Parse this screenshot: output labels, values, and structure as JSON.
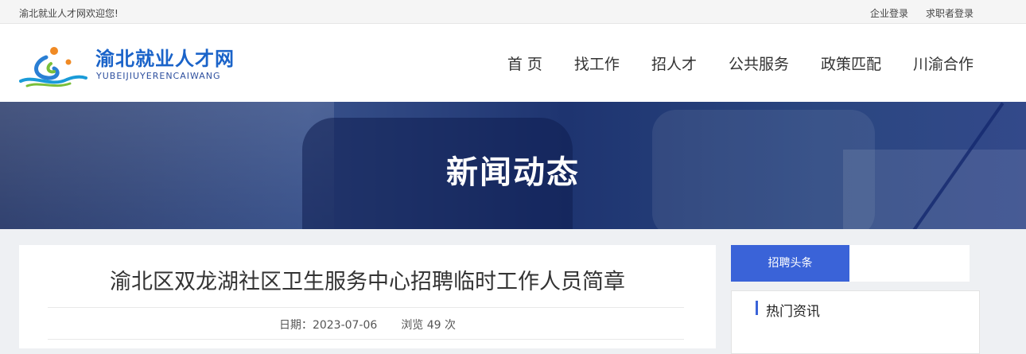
{
  "topbar": {
    "welcome": "渝北就业人才网欢迎您!",
    "company_login": "企业登录",
    "seeker_login": "求职者登录"
  },
  "logo": {
    "name_cn": "渝北就业人才网",
    "name_en": "YUBEIJIUYERENCAIWANG"
  },
  "nav": {
    "items": [
      "首 页",
      "找工作",
      "招人才",
      "公共服务",
      "政策匹配",
      "川渝合作"
    ]
  },
  "banner": {
    "title": "新闻动态"
  },
  "article": {
    "title": "渝北区双龙湖社区卫生服务中心招聘临时工作人员简章",
    "date_label": "日期：",
    "date": "2023-07-06",
    "views_label": "浏览",
    "views": "49",
    "views_unit": "次"
  },
  "sidebar": {
    "tab_label": "招聘头条",
    "hot_title": "热门资讯"
  },
  "colors": {
    "accent": "#3a63d8",
    "logo_text": "#1a63c9"
  }
}
